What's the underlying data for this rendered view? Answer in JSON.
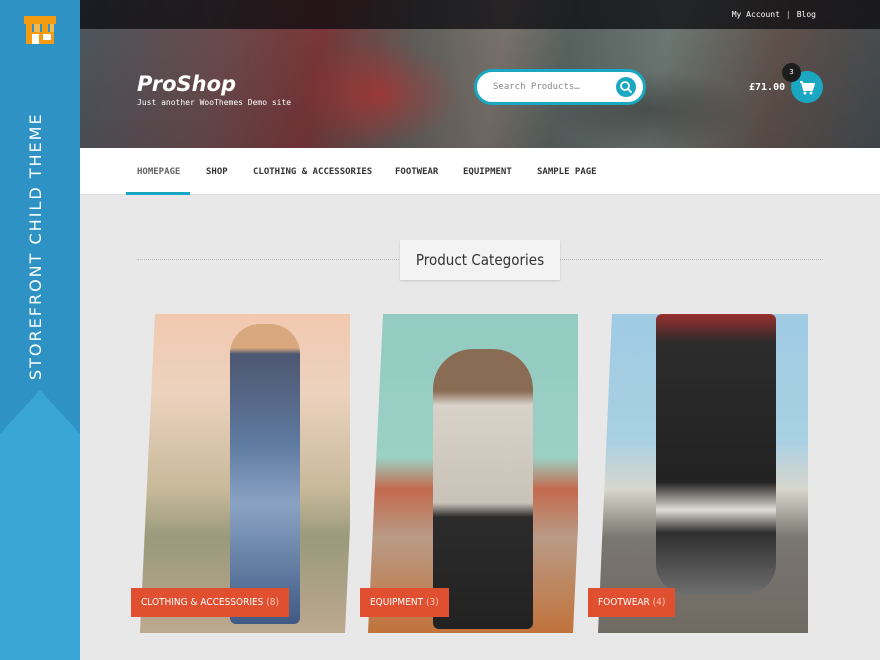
{
  "theme_banner": {
    "text": "STOREFRONT CHILD THEME",
    "color": "#3aa6d8"
  },
  "topbar": {
    "links": [
      "My Account",
      "Blog"
    ],
    "separator": "|"
  },
  "site": {
    "title": "ProShop",
    "tagline": "Just another WooThemes Demo site"
  },
  "search": {
    "placeholder": "Search Products…",
    "icon": "search-icon",
    "accent": "#1aa7c2"
  },
  "cart": {
    "total": "£71.00",
    "count": "3",
    "icon": "cart-icon"
  },
  "nav": {
    "items": [
      "HOMEPAGE",
      "SHOP",
      "CLOTHING & ACCESSORIES",
      "FOOTWEAR",
      "EQUIPMENT",
      "SAMPLE PAGE"
    ],
    "active_index": 0
  },
  "section": {
    "title": "Product Categories"
  },
  "categories": [
    {
      "name": "CLOTHING & ACCESSORIES",
      "count": "(8)"
    },
    {
      "name": "EQUIPMENT",
      "count": "(3)"
    },
    {
      "name": "FOOTWEAR",
      "count": "(4)"
    }
  ],
  "colors": {
    "label_bg": "#e04f2f",
    "nav_underline": "#1aa7c2"
  }
}
